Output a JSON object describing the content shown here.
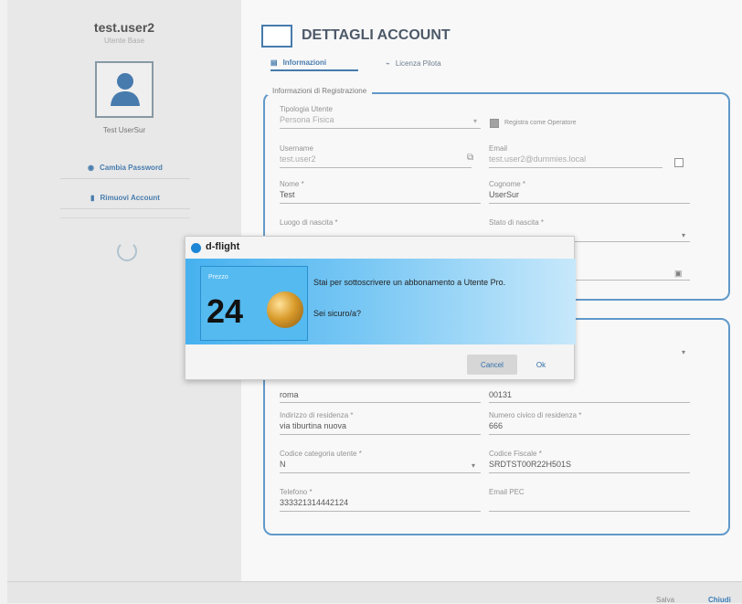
{
  "sidebar": {
    "username": "test.user2",
    "role": "Utente Base",
    "full_name": "Test UserSur",
    "change_password": "Cambia Password",
    "remove_account": "Rimuovi Account"
  },
  "header": {
    "title": "DETTAGLI ACCOUNT",
    "tabs": [
      {
        "label": "Informazioni"
      },
      {
        "label": "Licenza Pilota"
      }
    ]
  },
  "registration": {
    "legend": "Informazioni di Registrazione",
    "user_type_label": "Tipologia Utente",
    "user_type_value": "Persona Fisica",
    "register_as_operator": "Registra come Operatore",
    "username_label": "Username",
    "username_value": "test.user2",
    "email_label": "Email",
    "email_value": "test.user2@dummies.local",
    "name_label": "Nome *",
    "name_value": "Test",
    "surname_label": "Cognome *",
    "surname_value": "UserSur",
    "birthplace_label": "Luogo di nascita *",
    "birthstate_label": "Stato di nascita *",
    "birthplace_value": "",
    "birthstate_value": ""
  },
  "details": {
    "city_value": "roma",
    "cap_value": "00131",
    "address_label": "Indirizzo di residenza *",
    "address_value": "via tiburtina nuova",
    "house_number_label": "Numero civico di residenza *",
    "house_number_value": "666",
    "category_label": "Codice categoria utente *",
    "category_value": "N",
    "fiscal_code_label": "Codice Fiscale *",
    "fiscal_code_value": "SRDTST00R22H501S",
    "phone_label": "Telefono *",
    "phone_value": "333321314442124",
    "pec_label": "Email PEC"
  },
  "dialog": {
    "brand": "d-flight",
    "price_label": "Prezzo",
    "price": "24",
    "message": "Stai per sottoscrivere un abbonamento a Utente Pro.",
    "question": "Sei sicuro/a?",
    "cancel": "Cancel",
    "ok": "Ok"
  },
  "footer": {
    "left": "Salva",
    "right": "Chiudi"
  },
  "colors": {
    "accent": "#1f5f9c",
    "dialog_blue": "#46b1ef"
  }
}
